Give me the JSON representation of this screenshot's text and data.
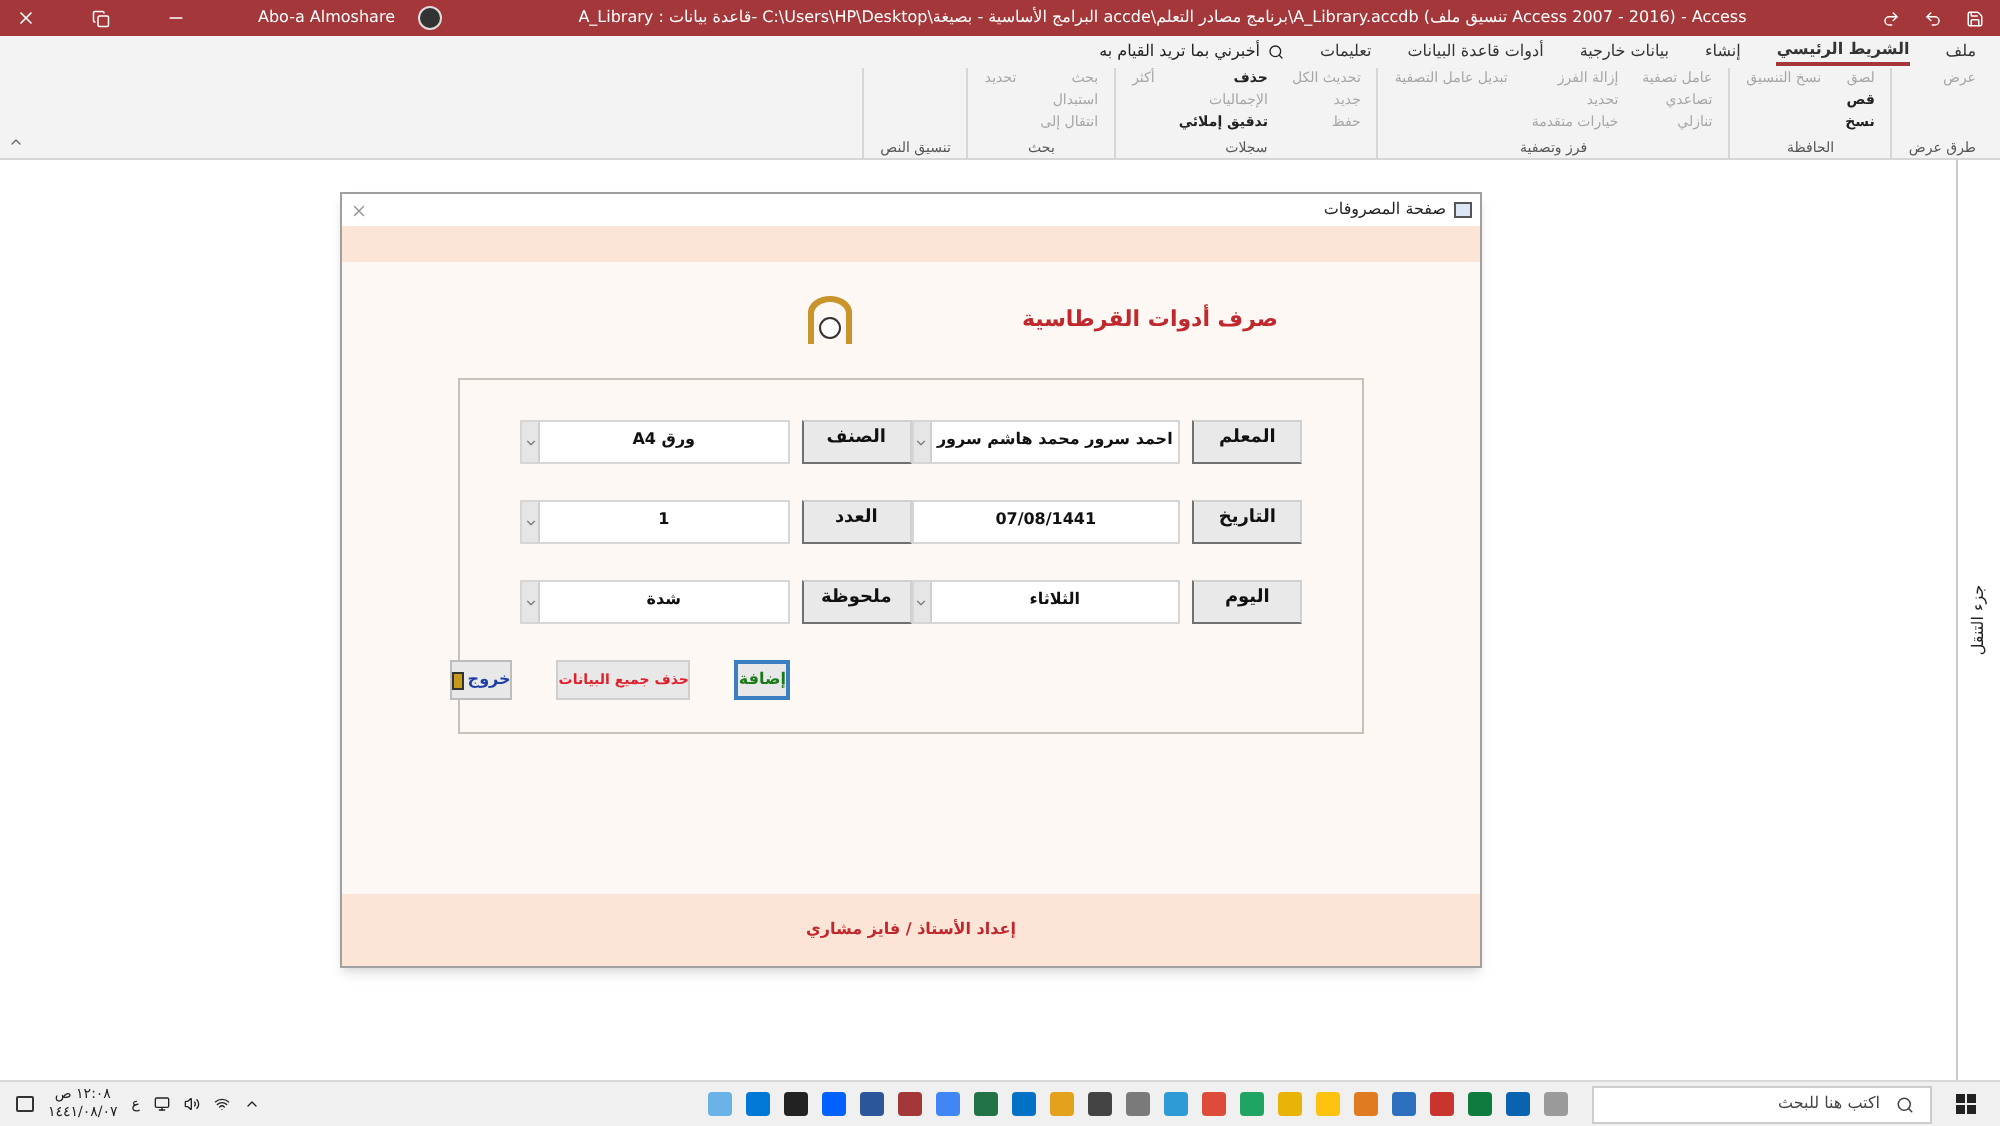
{
  "window": {
    "title": "A_Library : قاعدة بيانات- C:\\Users\\HP\\Desktop\\البرامج الأساسية - بصيغة accde\\برنامج مصادر التعلم\\A_Library.accdb (تنسيق ملف Access 2007 - 2016) - Access",
    "user": "Abo-a Almoshare"
  },
  "ribbon": {
    "tabs": [
      {
        "label": "ملف",
        "selected": false
      },
      {
        "label": "الشريط الرئيسي",
        "selected": true
      },
      {
        "label": "إنشاء",
        "selected": false
      },
      {
        "label": "بيانات خارجية",
        "selected": false
      },
      {
        "label": "أدوات قاعدة البيانات",
        "selected": false
      },
      {
        "label": "تعليمات",
        "selected": false
      }
    ],
    "tell_me": "أخبرني بما تريد القيام به",
    "groups": [
      {
        "label": "طرق عرض",
        "commands": [
          {
            "label": "عرض",
            "disabled": true
          }
        ]
      },
      {
        "label": "الحافظة",
        "commands": [
          {
            "label": "لصق",
            "disabled": true
          },
          {
            "label": "قص",
            "disabled": false
          },
          {
            "label": "نسخ",
            "disabled": false
          },
          {
            "label": "نسخ التنسيق",
            "disabled": true
          }
        ]
      },
      {
        "label": "فرز وتصفية",
        "commands": [
          {
            "label": "عامل تصفية",
            "disabled": true
          },
          {
            "label": "تصاعدي",
            "disabled": true
          },
          {
            "label": "تنازلي",
            "disabled": true
          },
          {
            "label": "إزالة الفرز",
            "disabled": true
          },
          {
            "label": "تحديد",
            "disabled": true
          },
          {
            "label": "خيارات متقدمة",
            "disabled": true
          },
          {
            "label": "تبديل عامل التصفية",
            "disabled": true
          }
        ]
      },
      {
        "label": "سجلات",
        "commands": [
          {
            "label": "تحديث الكل",
            "disabled": true
          },
          {
            "label": "جديد",
            "disabled": true
          },
          {
            "label": "حفظ",
            "disabled": true
          },
          {
            "label": "حذف",
            "disabled": false
          },
          {
            "label": "الإجماليات",
            "disabled": true
          },
          {
            "label": "تدقيق إملائي",
            "disabled": false
          },
          {
            "label": "أكثر",
            "disabled": true
          }
        ]
      },
      {
        "label": "بحث",
        "commands": [
          {
            "label": "بحث",
            "disabled": true
          },
          {
            "label": "استبدال",
            "disabled": true
          },
          {
            "label": "انتقال إلى",
            "disabled": true
          },
          {
            "label": "تحديد",
            "disabled": true
          }
        ]
      },
      {
        "label": "تنسيق النص"
      }
    ]
  },
  "navigation_pane": {
    "label": "جزء التنقل"
  },
  "form": {
    "title": "صفحة المصروفات",
    "heading": "صرف أدوات القرطاسية",
    "fields": [
      {
        "label": "المعلم",
        "value": "احمد سرور محمد هاشم سرور",
        "dropdown": true
      },
      {
        "label": "الصنف",
        "value": "ورق A4",
        "dropdown": true
      },
      {
        "label": "التاريخ",
        "value": "07/08/1441",
        "dropdown": false
      },
      {
        "label": "العدد",
        "value": "1",
        "dropdown": true
      },
      {
        "label": "اليوم",
        "value": "الثلاثاء",
        "dropdown": true
      },
      {
        "label": "ملحوظة",
        "value": "شدة",
        "dropdown": true
      }
    ],
    "buttons": [
      {
        "label": "إضافة",
        "kind": "add"
      },
      {
        "label": "حذف جميع البيانات",
        "kind": "clear"
      },
      {
        "label": "خروج",
        "kind": "exit"
      }
    ],
    "footer": "إعداد الأستاذ / فايز مشاري"
  },
  "taskbar": {
    "search_placeholder": "اكتب هنا للبحث",
    "language": "ع",
    "time": "١٢:٠٨ ص",
    "date": "١٤٤١/٠٨/٠٧"
  }
}
